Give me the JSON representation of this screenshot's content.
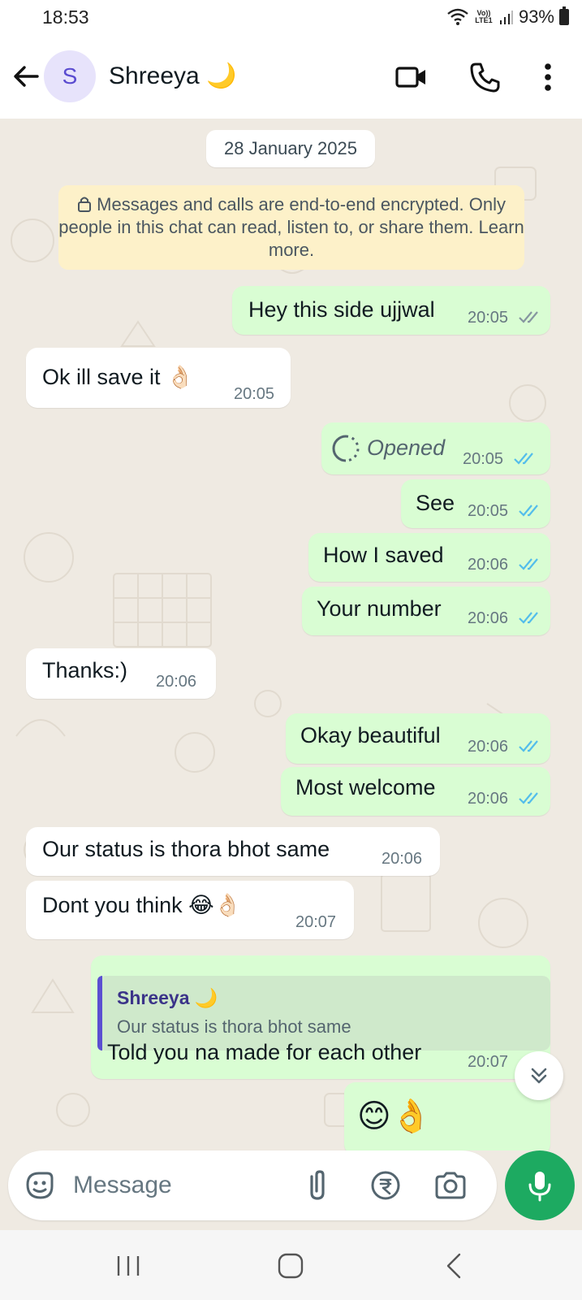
{
  "status_bar": {
    "time": "18:53",
    "network": "Vo)) LTE1",
    "battery": "93%"
  },
  "header": {
    "avatar_letter": "S",
    "contact_name": "Shreeya",
    "contact_emoji": "🌙",
    "icons": [
      "back-arrow-icon",
      "video-call-icon",
      "voice-call-icon",
      "more-options-icon"
    ]
  },
  "chat": {
    "date": "28 January 2025",
    "encryption_notice": "Messages and calls are end-to-end encrypted. Only people in this chat can read, listen to, or share them. Learn more.",
    "messages": [
      {
        "direction": "out",
        "text": "Hey this side ujjwal",
        "time": "20:05",
        "status": "delivered"
      },
      {
        "direction": "in",
        "text": "Ok ill save it 👌🏻",
        "time": "20:05"
      },
      {
        "direction": "out",
        "text": "Opened",
        "time": "20:05",
        "status": "read",
        "kind": "view-once-opened"
      },
      {
        "direction": "out",
        "text": "See",
        "time": "20:05",
        "status": "read"
      },
      {
        "direction": "out",
        "text": "How I saved",
        "time": "20:06",
        "status": "read"
      },
      {
        "direction": "out",
        "text": "Your number",
        "time": "20:06",
        "status": "read"
      },
      {
        "direction": "in",
        "text": "Thanks:)",
        "time": "20:06"
      },
      {
        "direction": "out",
        "text": "Okay beautiful",
        "time": "20:06",
        "status": "read"
      },
      {
        "direction": "out",
        "text": "Most welcome",
        "time": "20:06",
        "status": "read"
      },
      {
        "direction": "in",
        "text": "Our status is thora bhot same",
        "time": "20:06"
      },
      {
        "direction": "in",
        "text": "Dont you think 😂👌🏻",
        "time": "20:07"
      },
      {
        "direction": "out",
        "text": "Told you na made for each other",
        "time": "20:07",
        "status": "read",
        "reply_to": {
          "name": "Shreeya 🌙",
          "text": "Our status is thora bhot same"
        }
      },
      {
        "direction": "out",
        "text": "😊👌",
        "time": "",
        "status": ""
      }
    ]
  },
  "input": {
    "placeholder": "Message"
  },
  "colors": {
    "outgoing": "#d9fdd3",
    "incoming": "#ffffff",
    "accent": "#1daa61",
    "read_tick": "#53bdeb"
  }
}
